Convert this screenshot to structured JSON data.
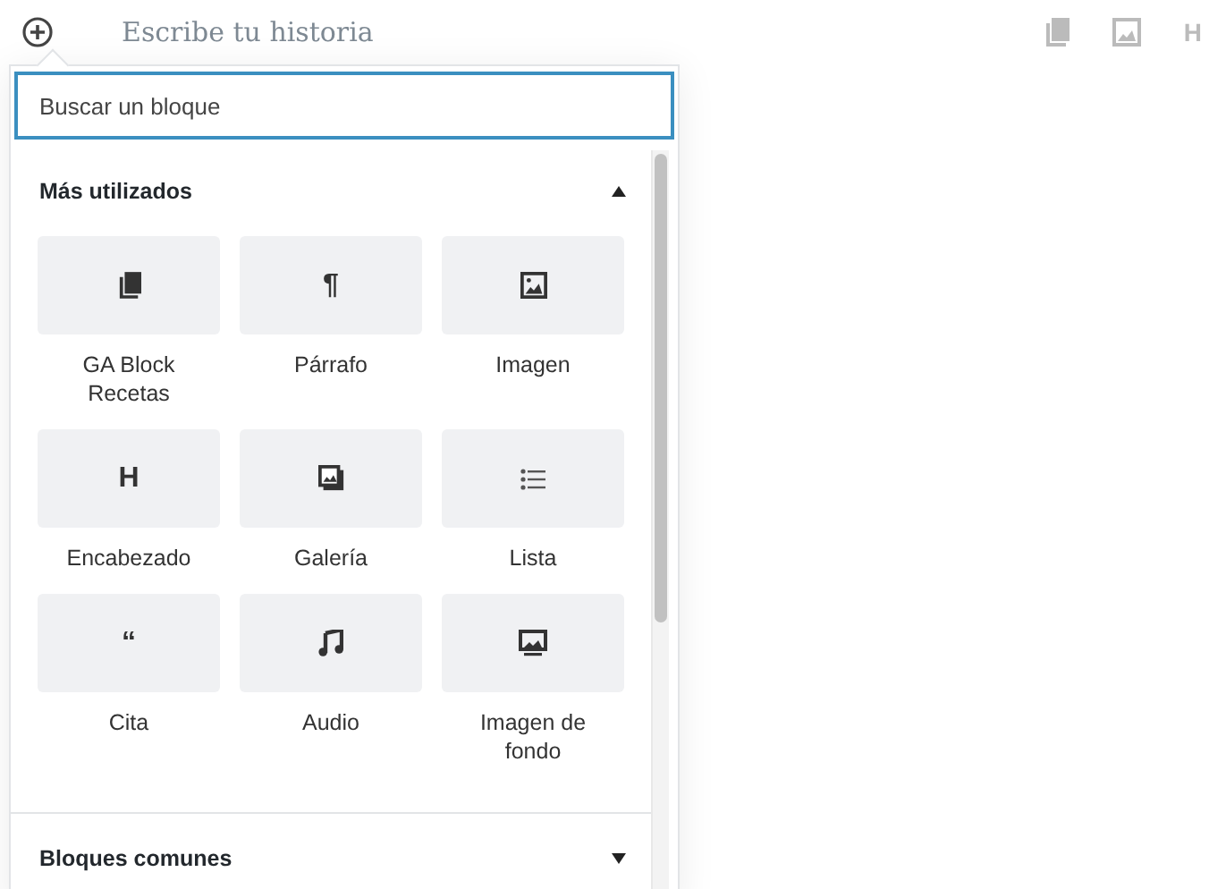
{
  "toolbar": {
    "title_placeholder": "Escribe tu historia",
    "right_tools": [
      {
        "kind": "copy"
      },
      {
        "kind": "image"
      },
      {
        "kind": "glyph",
        "glyph": "H"
      }
    ]
  },
  "inserter": {
    "search": {
      "placeholder": "Buscar un bloque"
    },
    "sections": [
      {
        "title": "Más utilizados",
        "expanded": true,
        "blocks": [
          {
            "label": "GA Block Recetas",
            "kind": "copy"
          },
          {
            "label": "Párrafo",
            "kind": "glyph",
            "glyph": "¶"
          },
          {
            "label": "Imagen",
            "kind": "image"
          },
          {
            "label": "Encabezado",
            "kind": "glyph",
            "glyph": "H"
          },
          {
            "label": "Galería",
            "kind": "gallery"
          },
          {
            "label": "Lista",
            "kind": "list"
          },
          {
            "label": "Cita",
            "kind": "glyph",
            "glyph": "“"
          },
          {
            "label": "Audio",
            "kind": "music"
          },
          {
            "label": "Imagen de fondo",
            "kind": "cover"
          }
        ]
      },
      {
        "title": "Bloques comunes",
        "expanded": false
      }
    ]
  }
}
